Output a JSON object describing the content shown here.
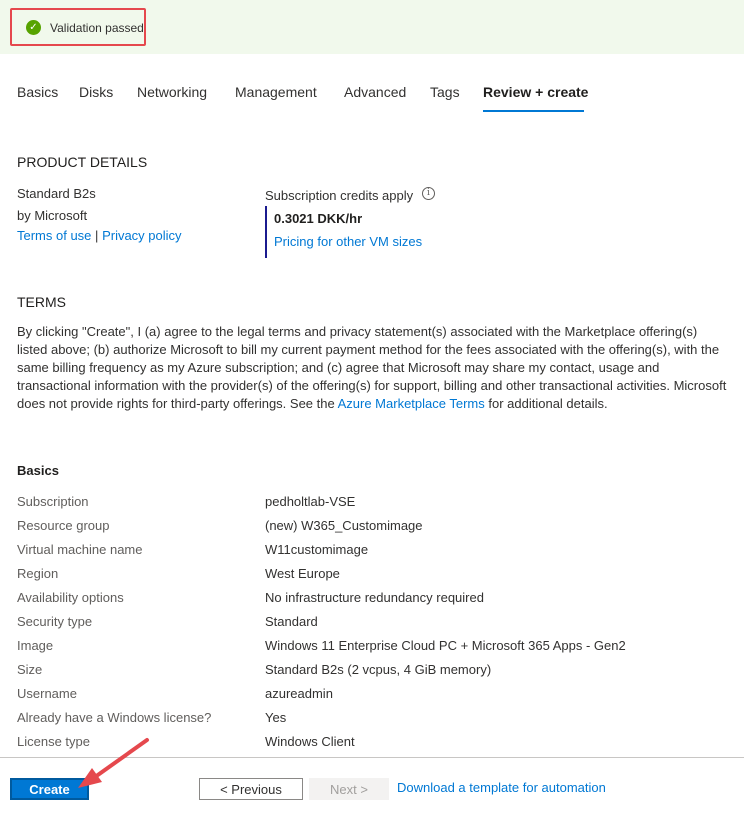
{
  "banner": {
    "status_text": "Validation passed",
    "status_color": "#57a300",
    "icon": "checkmark-circle-icon"
  },
  "tabs": [
    {
      "label": "Basics"
    },
    {
      "label": "Disks"
    },
    {
      "label": "Networking"
    },
    {
      "label": "Management"
    },
    {
      "label": "Advanced"
    },
    {
      "label": "Tags"
    },
    {
      "label": "Review + create",
      "active": true
    }
  ],
  "product": {
    "heading": "PRODUCT DETAILS",
    "name": "Standard B2s",
    "publisher": "by Microsoft",
    "terms_link": "Terms of use",
    "separator": "|",
    "privacy_link": "Privacy policy",
    "credits_label": "Subscription credits apply",
    "price": "0.3021 DKK/hr",
    "pricing_link": "Pricing for other VM sizes"
  },
  "terms": {
    "heading": "TERMS",
    "text_before": "By clicking \"Create\", I (a) agree to the legal terms and privacy statement(s) associated with the Marketplace offering(s) listed above; (b) authorize Microsoft to bill my current payment method for the fees associated with the offering(s), with the same billing frequency as my Azure subscription; and (c) agree that Microsoft may share my contact, usage and transactional information with the provider(s) of the offering(s) for support, billing and other transactional activities. Microsoft does not provide rights for third-party offerings. See the ",
    "link": "Azure Marketplace Terms",
    "text_after": " for additional details."
  },
  "basics": {
    "heading": "Basics",
    "rows": [
      {
        "label": "Subscription",
        "value": "pedholtlab-VSE"
      },
      {
        "label": "Resource group",
        "value": "(new) W365_Customimage"
      },
      {
        "label": "Virtual machine name",
        "value": "W11customimage"
      },
      {
        "label": "Region",
        "value": "West Europe"
      },
      {
        "label": "Availability options",
        "value": "No infrastructure redundancy required"
      },
      {
        "label": "Security type",
        "value": "Standard"
      },
      {
        "label": "Image",
        "value": "Windows 11 Enterprise Cloud PC + Microsoft 365 Apps - Gen2"
      },
      {
        "label": "Size",
        "value": "Standard B2s (2 vcpus, 4 GiB memory)"
      },
      {
        "label": "Username",
        "value": "azureadmin"
      },
      {
        "label": "Already have a Windows license?",
        "value": "Yes"
      },
      {
        "label": "License type",
        "value": "Windows Client"
      }
    ]
  },
  "footer": {
    "create_label": "Create",
    "previous_label": "< Previous",
    "next_label": "Next >",
    "download_link": "Download a template for automation"
  },
  "colors": {
    "accent": "#0078d4",
    "annotation": "#e5484d"
  }
}
